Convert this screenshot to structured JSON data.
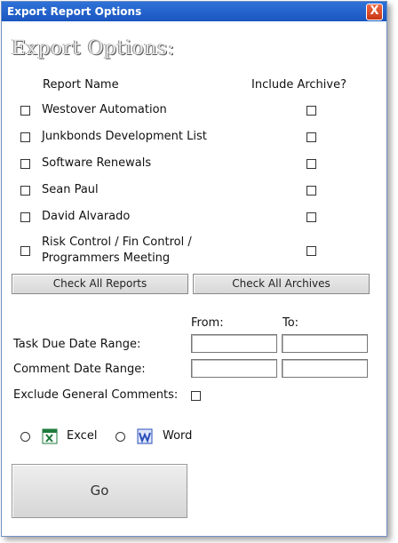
{
  "window": {
    "title": "Export Report Options",
    "close_glyph": "X"
  },
  "heading": "Export Options:",
  "columns": {
    "report_name": "Report Name",
    "include_archive": "Include Archive?"
  },
  "reports": [
    {
      "label": "Westover Automation"
    },
    {
      "label": "Junkbonds Development List"
    },
    {
      "label": "Software Renewals"
    },
    {
      "label": "Sean Paul"
    },
    {
      "label": "David Alvarado"
    },
    {
      "label": "Risk Control / Fin Control /\nProgrammers Meeting"
    }
  ],
  "buttons": {
    "check_all_reports": "Check All Reports",
    "check_all_archives": "Check All Archives",
    "go": "Go"
  },
  "ranges": {
    "from_label": "From:",
    "to_label": "To:",
    "task_due": {
      "label": "Task Due Date Range:",
      "from": "",
      "to": ""
    },
    "comment": {
      "label": "Comment Date Range:",
      "from": "",
      "to": ""
    }
  },
  "exclude_general": {
    "label": "Exclude General Comments:"
  },
  "format": {
    "excel_label": "Excel",
    "word_label": "Word",
    "excel_icon": "excel-icon",
    "word_icon": "word-icon"
  },
  "colors": {
    "titlebar": "#1b55c0",
    "excel": "#1e7b3c",
    "word": "#2a4fb8"
  }
}
